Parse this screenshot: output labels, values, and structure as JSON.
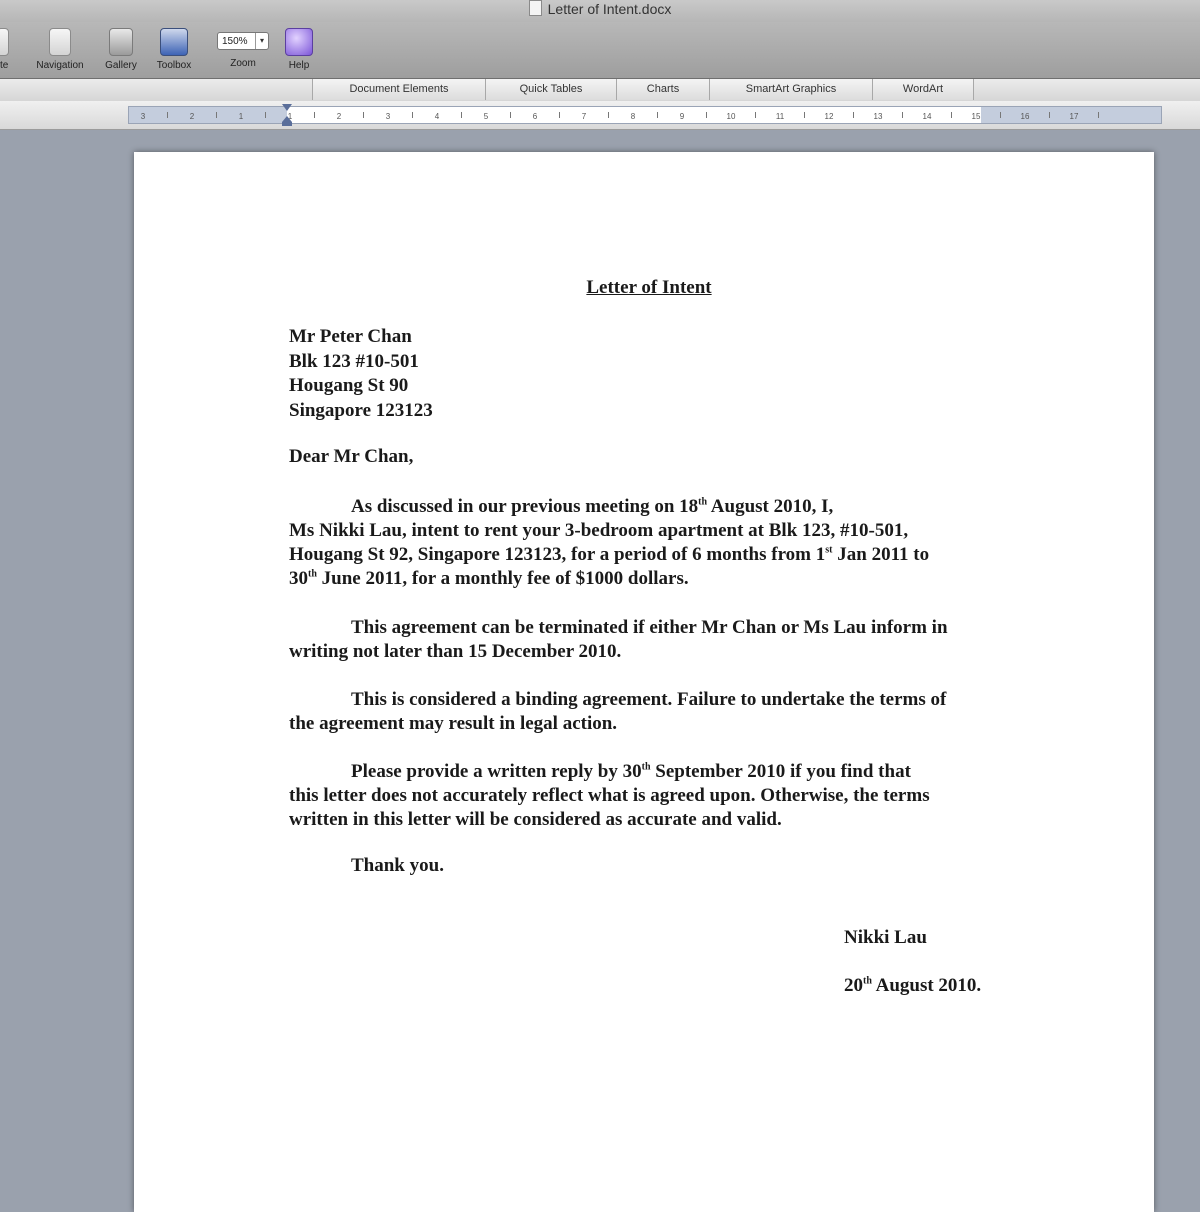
{
  "window": {
    "title": "Letter of Intent.docx"
  },
  "toolbar": {
    "partial_label": "ite",
    "navigation_label": "Navigation",
    "gallery_label": "Gallery",
    "toolbox_label": "Toolbox",
    "zoom_label": "Zoom",
    "zoom_value": "150%",
    "help_label": "Help"
  },
  "ribbon": {
    "tabs": [
      {
        "label": "Document Elements"
      },
      {
        "label": "Quick Tables"
      },
      {
        "label": "Charts"
      },
      {
        "label": "SmartArt Graphics"
      },
      {
        "label": "WordArt"
      }
    ]
  },
  "ruler": {
    "labels": [
      "3",
      "2",
      "1",
      "1",
      "2",
      "3",
      "4",
      "5",
      "6",
      "7",
      "8",
      "9",
      "10",
      "11",
      "12",
      "13",
      "14",
      "15",
      "16",
      "17"
    ]
  },
  "letter": {
    "title": "Letter of Intent",
    "address": [
      "Mr Peter Chan",
      "Blk 123 #10-501",
      "Hougang St 90",
      "Singapore 123123"
    ],
    "salutation": "Dear Mr Chan,",
    "p1": {
      "a": "As discussed in our previous meeting on 18",
      "a_sup": "th",
      "b": " August 2010, I,",
      "c": "Ms Nikki Lau, intent to rent your 3-bedroom apartment at Blk 123, #10-501,",
      "d": "Hougang St 92, Singapore 123123, for a period of 6 months  from 1",
      "d_sup": "st",
      "e": " Jan 2011 to",
      "f": "30",
      "f_sup": "th",
      "g": " June 2011, for a monthly fee of $1000 dollars."
    },
    "p2": {
      "a": "This agreement can be terminated if either Mr Chan or Ms Lau inform in",
      "b": "writing not later than 15 December 2010."
    },
    "p3": {
      "a": "This is considered a binding agreement. Failure to undertake the terms of",
      "b": "the agreement may result in legal action."
    },
    "p4": {
      "a": "Please provide a written reply by 30",
      "a_sup": "th",
      "b": " September 2010 if you find that",
      "c": "this letter does not accurately reflect what is agreed upon. Otherwise, the terms",
      "d": "written in this letter will be considered as accurate and valid."
    },
    "closing": "Thank you.",
    "signature_name": "Nikki Lau",
    "signature_date_day": "20",
    "signature_date_sup": "th",
    "signature_date_rest": " August 2010."
  }
}
